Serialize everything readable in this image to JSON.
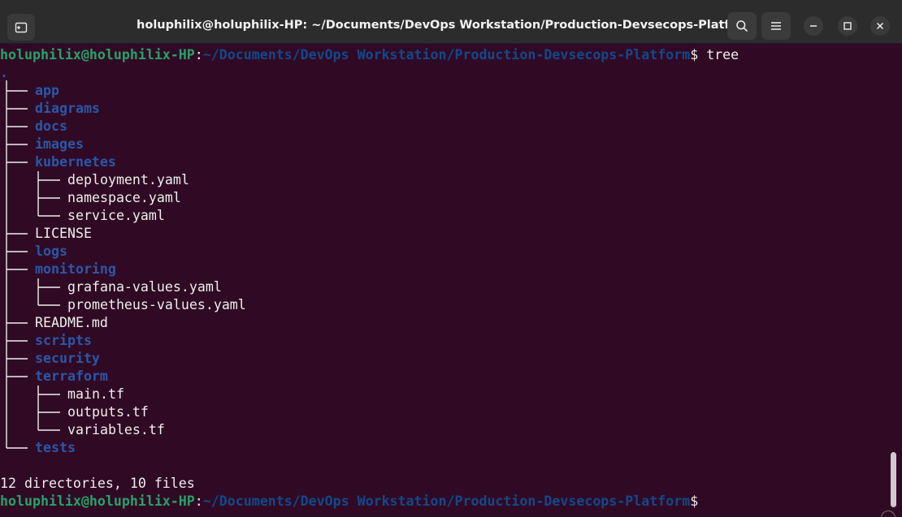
{
  "window": {
    "title": "holuphilix@holuphilix-HP: ~/Documents/DevOps Workstation/Production-Devsecops-Platform",
    "buttons": {
      "new_tab_icon": "new-tab-icon",
      "search_icon": "search-icon",
      "menu_icon": "hamburger-menu-icon",
      "minimize_icon": "minimize-icon",
      "maximize_icon": "maximize-icon",
      "close_icon": "close-icon"
    }
  },
  "colors": {
    "background": "#300a24",
    "prompt_user": "#26a269",
    "prompt_path": "#12488b",
    "directory": "#2a57a8",
    "text": "#eeeeec"
  },
  "terminal": {
    "prompt1": {
      "user": "holuphilix@holuphilix-HP",
      "sep": ":",
      "path": "~/Documents/DevOps Workstation/Production-Devsecops-Platform",
      "dollar": "$ ",
      "command": "tree"
    },
    "root": ".",
    "entries": [
      {
        "name": "app",
        "dir": true,
        "level": 1
      },
      {
        "name": "diagrams",
        "dir": true,
        "level": 1
      },
      {
        "name": "docs",
        "dir": true,
        "level": 1
      },
      {
        "name": "images",
        "dir": true,
        "level": 1
      },
      {
        "name": "kubernetes",
        "dir": true,
        "level": 1
      },
      {
        "name": "deployment.yaml",
        "dir": false,
        "level": 2
      },
      {
        "name": "namespace.yaml",
        "dir": false,
        "level": 2
      },
      {
        "name": "service.yaml",
        "dir": false,
        "level": 2
      },
      {
        "name": "LICENSE",
        "dir": false,
        "level": 1
      },
      {
        "name": "logs",
        "dir": true,
        "level": 1
      },
      {
        "name": "monitoring",
        "dir": true,
        "level": 1
      },
      {
        "name": "grafana-values.yaml",
        "dir": false,
        "level": 2
      },
      {
        "name": "prometheus-values.yaml",
        "dir": false,
        "level": 2
      },
      {
        "name": "README.md",
        "dir": false,
        "level": 1
      },
      {
        "name": "scripts",
        "dir": true,
        "level": 1
      },
      {
        "name": "security",
        "dir": true,
        "level": 1
      },
      {
        "name": "terraform",
        "dir": true,
        "level": 1
      },
      {
        "name": "main.tf",
        "dir": false,
        "level": 2
      },
      {
        "name": "outputs.tf",
        "dir": false,
        "level": 2
      },
      {
        "name": "variables.tf",
        "dir": false,
        "level": 2
      },
      {
        "name": "tests",
        "dir": true,
        "level": 1
      }
    ],
    "summary": "12 directories, 10 files",
    "prompt2": {
      "user": "holuphilix@holuphilix-HP",
      "sep": ":",
      "path": "~/Documents/DevOps Workstation/Production-Devsecops-Platform",
      "dollar": "$"
    }
  }
}
